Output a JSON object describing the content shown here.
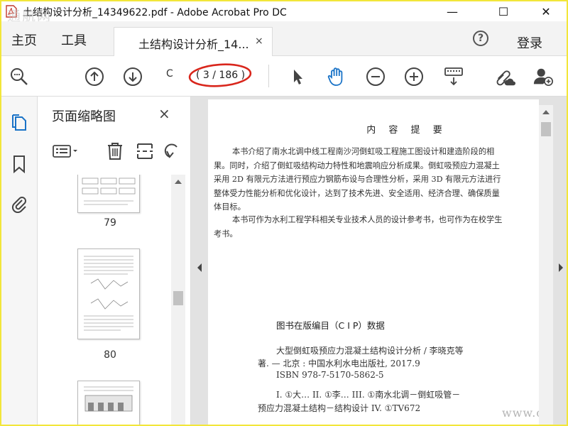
{
  "window": {
    "title": "土结构设计分析_14349622.pdf - Adobe Acrobat Pro DC",
    "watermark_top": "通航网",
    "controls": {
      "minimize": "—",
      "maximize": "☐",
      "close": "✕"
    }
  },
  "menu": {
    "home": "主页",
    "tools": "工具",
    "doc_tab": "土结构设计分析_14...",
    "tab_close": "×",
    "help": "?",
    "login": "登录"
  },
  "toolbar": {
    "page_input": "C",
    "page_count": "( 3 / 186 )",
    "icons": [
      "search-icon",
      "prev-page-icon",
      "next-page-icon",
      "select-cursor-icon",
      "hand-tool-icon",
      "zoom-out-icon",
      "zoom-in-icon",
      "keyboard-scroll-icon",
      "share-link-icon",
      "add-user-icon"
    ],
    "annotation_color": "#d9261c"
  },
  "thumbnails": {
    "title": "页面缩略图",
    "close": "×",
    "tool_icons": [
      "options-menu-icon",
      "delete-icon",
      "extract-icon",
      "undo-icon"
    ],
    "pages": [
      {
        "label": "79"
      },
      {
        "label": "80"
      }
    ]
  },
  "document": {
    "heading": "内 容 提 要",
    "paragraphs": [
      "本书介绍了南水北调中线工程南沙河倒虹吸工程施工图设计和建造阶段的相",
      "果。同时，介绍了倒虹吸结构动力特性和地震响应分析成果。倒虹吸预应力混凝土",
      "采用 2D 有限元方法进行预应力钢筋布设与合理性分析，采用 3D 有限元方法进行",
      "整体受力性能分析和优化设计，达到了技术先进、安全适用、经济合理、确保质量",
      "体目标。",
      "本书可作为水利工程学科相关专业技术人员的设计参考书，也可作为在校学生",
      "考书。"
    ],
    "cip_title": "图书在版编目（C I P）数据",
    "cip_lines": [
      "大型倒虹吸预应力混凝土结构设计分析 / 李晓克等",
      "著. — 北京 : 中国水利水电出版社, 2017.9",
      "ISBN 978-7-5170-5862-5",
      "I. ①大… II. ①李… III. ①南水北调－倒虹吸管－",
      "预应力混凝土结构－结构设计 IV. ①TV672"
    ],
    "watermark": "www.cndao.com"
  }
}
